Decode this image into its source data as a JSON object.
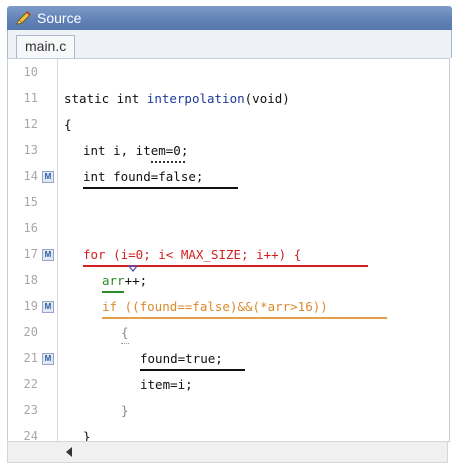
{
  "window": {
    "title": "Source",
    "title_icon": "pencil-source-icon"
  },
  "tabs": [
    {
      "label": "main.c",
      "active": true
    }
  ],
  "editor": {
    "lines": [
      {
        "num": "10",
        "marker": false,
        "text": ""
      },
      {
        "num": "11",
        "marker": false,
        "text": "static int interpolation(void)"
      },
      {
        "num": "12",
        "marker": false,
        "text": "{"
      },
      {
        "num": "13",
        "marker": false,
        "text": "int i, item=0;"
      },
      {
        "num": "14",
        "marker": true,
        "text": "int found=false;"
      },
      {
        "num": "15",
        "marker": false,
        "text": ""
      },
      {
        "num": "16",
        "marker": false,
        "text": ""
      },
      {
        "num": "17",
        "marker": true,
        "text": "for (i=0; i< MAX_SIZE; i++) {"
      },
      {
        "num": "18",
        "marker": false,
        "text": "arr++;"
      },
      {
        "num": "19",
        "marker": true,
        "text": "if ((found==false)&&(*arr>16))"
      },
      {
        "num": "20",
        "marker": false,
        "text": "{"
      },
      {
        "num": "21",
        "marker": true,
        "text": "found=true;"
      },
      {
        "num": "22",
        "marker": false,
        "text": "item=i;"
      },
      {
        "num": "23",
        "marker": false,
        "text": "}"
      },
      {
        "num": "24",
        "marker": false,
        "text": "}"
      }
    ],
    "marker_label": "M",
    "colors": {
      "keyword": "#111111",
      "function": "#1e3a9a",
      "error_red": "#d42020",
      "warning_orange": "#d98a2b",
      "ok_green": "#2a8a2a",
      "line_number": "#a8a8a8"
    }
  },
  "scrollbar": {
    "left_arrow_icon": "scroll-left-arrow-icon"
  }
}
